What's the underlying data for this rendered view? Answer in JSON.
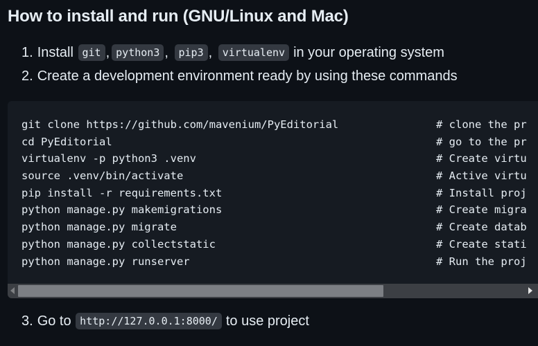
{
  "heading": "How to install and run (GNU/Linux and Mac)",
  "step1": {
    "number": "1.",
    "prefix": "Install",
    "codes": [
      "git",
      "python3",
      "pip3",
      "virtualenv"
    ],
    "separator": ",",
    "suffix": "in your operating system"
  },
  "step2": {
    "number": "2.",
    "text": "Create a development environment ready by using these commands"
  },
  "code_block": {
    "lines": [
      {
        "cmd": "git clone https://github.com/mavenium/PyEditorial",
        "comment": "# clone the pr"
      },
      {
        "cmd": "cd PyEditorial",
        "comment": "# go to the pr"
      },
      {
        "cmd": "virtualenv -p python3 .venv",
        "comment": "# Create virtu"
      },
      {
        "cmd": "source .venv/bin/activate",
        "comment": "# Active virtu"
      },
      {
        "cmd": "pip install -r requirements.txt",
        "comment": "# Install proj"
      },
      {
        "cmd": "python manage.py makemigrations",
        "comment": "# Create migra"
      },
      {
        "cmd": "python manage.py migrate",
        "comment": "# Create datab"
      },
      {
        "cmd": "python manage.py collectstatic",
        "comment": "# Create stati"
      },
      {
        "cmd": "python manage.py runserver",
        "comment": "# Run the proj"
      }
    ],
    "scrollbar_position": 0
  },
  "step3": {
    "number": "3.",
    "prefix": "Go to",
    "code": "http://127.0.0.1:8000/",
    "suffix": "to use project"
  },
  "icons": {
    "scroll_left": "scroll-left-arrow-icon",
    "scroll_right": "scroll-right-arrow-icon"
  },
  "colors": {
    "background": "#0d1117",
    "code_background": "#161b22",
    "inline_code_background": "#343941",
    "text": "#e6edf3"
  }
}
